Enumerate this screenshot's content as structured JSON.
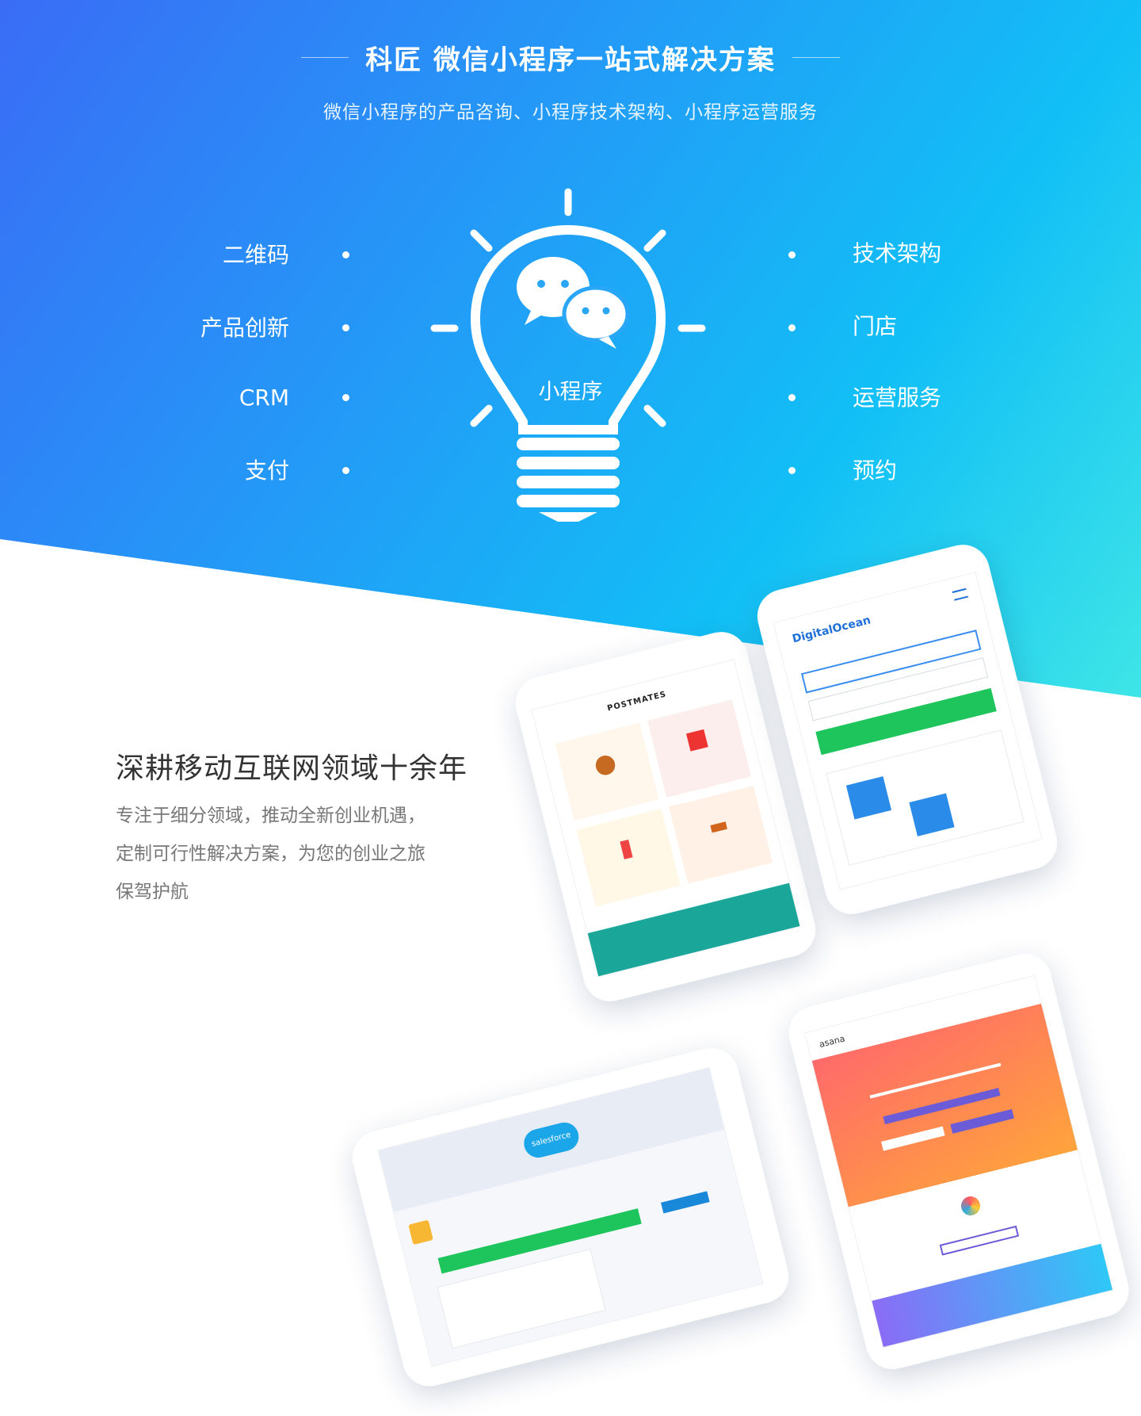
{
  "header": {
    "title": "科匠 微信小程序一站式解决方案",
    "subtitle": "微信小程序的产品咨询、小程序技术架构、小程序运营服务"
  },
  "features": {
    "left": [
      "二维码",
      "产品创新",
      "CRM",
      "支付"
    ],
    "right": [
      "技术架构",
      "门店",
      "运营服务",
      "预约"
    ]
  },
  "bulb": {
    "label": "小程序",
    "icon": "wechat-icon"
  },
  "section": {
    "title": "深耕移动互联网领域十余年",
    "desc_lines": [
      "专注于细分领域，推动全新创业机遇，",
      "定制可行性解决方案，为您的创业之旅",
      "保驾护航"
    ]
  },
  "mockups": {
    "postmates": "POSTMATES",
    "digitalocean": "DigitalOcean",
    "salesforce": "salesforce",
    "asana": "asana"
  },
  "colors": {
    "gradient_start": "#3a6cf6",
    "gradient_end": "#3fe6e6",
    "green": "#1ec45c",
    "blue": "#2a8be8",
    "orange": "#ff8a4c"
  }
}
